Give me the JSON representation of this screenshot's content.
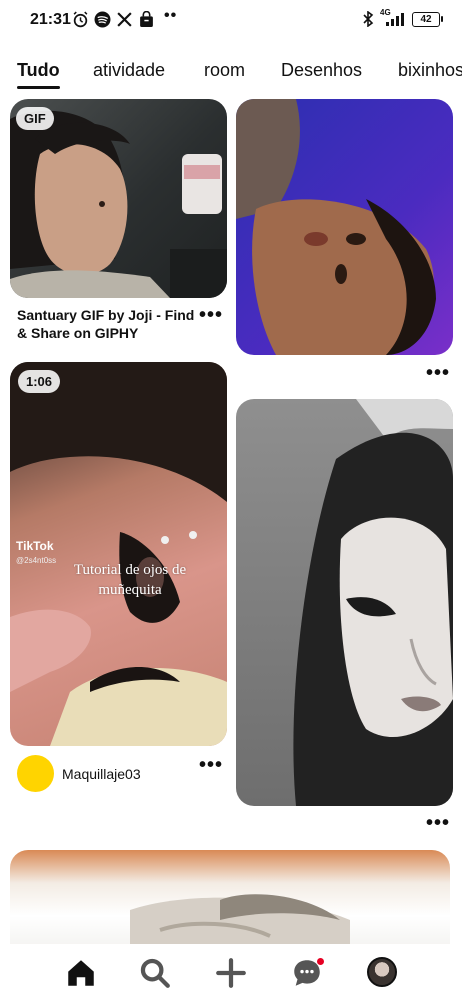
{
  "status_bar": {
    "time": "21:31",
    "icons": [
      "alarm-icon",
      "spotify-icon",
      "x-icon",
      "shopping-bag-icon"
    ],
    "overflow": "••",
    "right_icons": [
      "bluetooth-icon",
      "signal-4g-icon"
    ],
    "network": "4G",
    "battery": "42"
  },
  "tabs": [
    {
      "label": "Tudo",
      "active": true
    },
    {
      "label": "atividade",
      "active": false
    },
    {
      "label": "room",
      "active": false
    },
    {
      "label": "Desenhos",
      "active": false
    },
    {
      "label": "bixinhos",
      "active": false
    }
  ],
  "pins": {
    "giphy": {
      "badge": "GIF",
      "title": "Santuary GIF by Joji - Find & Share on GIPHY",
      "more": "•••"
    },
    "purple_portrait": {
      "more": "•••"
    },
    "tutorial": {
      "badge": "1:06",
      "tiktok_label": "TikTok",
      "tiktok_user": "@2s4nt0ss",
      "overlay_text": "Tutorial de ojos de muñequita",
      "creator": "Maquillaje03",
      "more": "•••"
    },
    "bw_portrait": {
      "more": "•••"
    },
    "bottom_pin": {}
  },
  "bottom_nav": {
    "items": [
      "home-icon",
      "search-icon",
      "create-icon",
      "messages-icon",
      "profile-icon"
    ],
    "active": "home-icon",
    "notification_color": "#e60023"
  },
  "colors": {
    "accent": "#e60023",
    "text": "#111111",
    "avatar": "#ffd400"
  }
}
